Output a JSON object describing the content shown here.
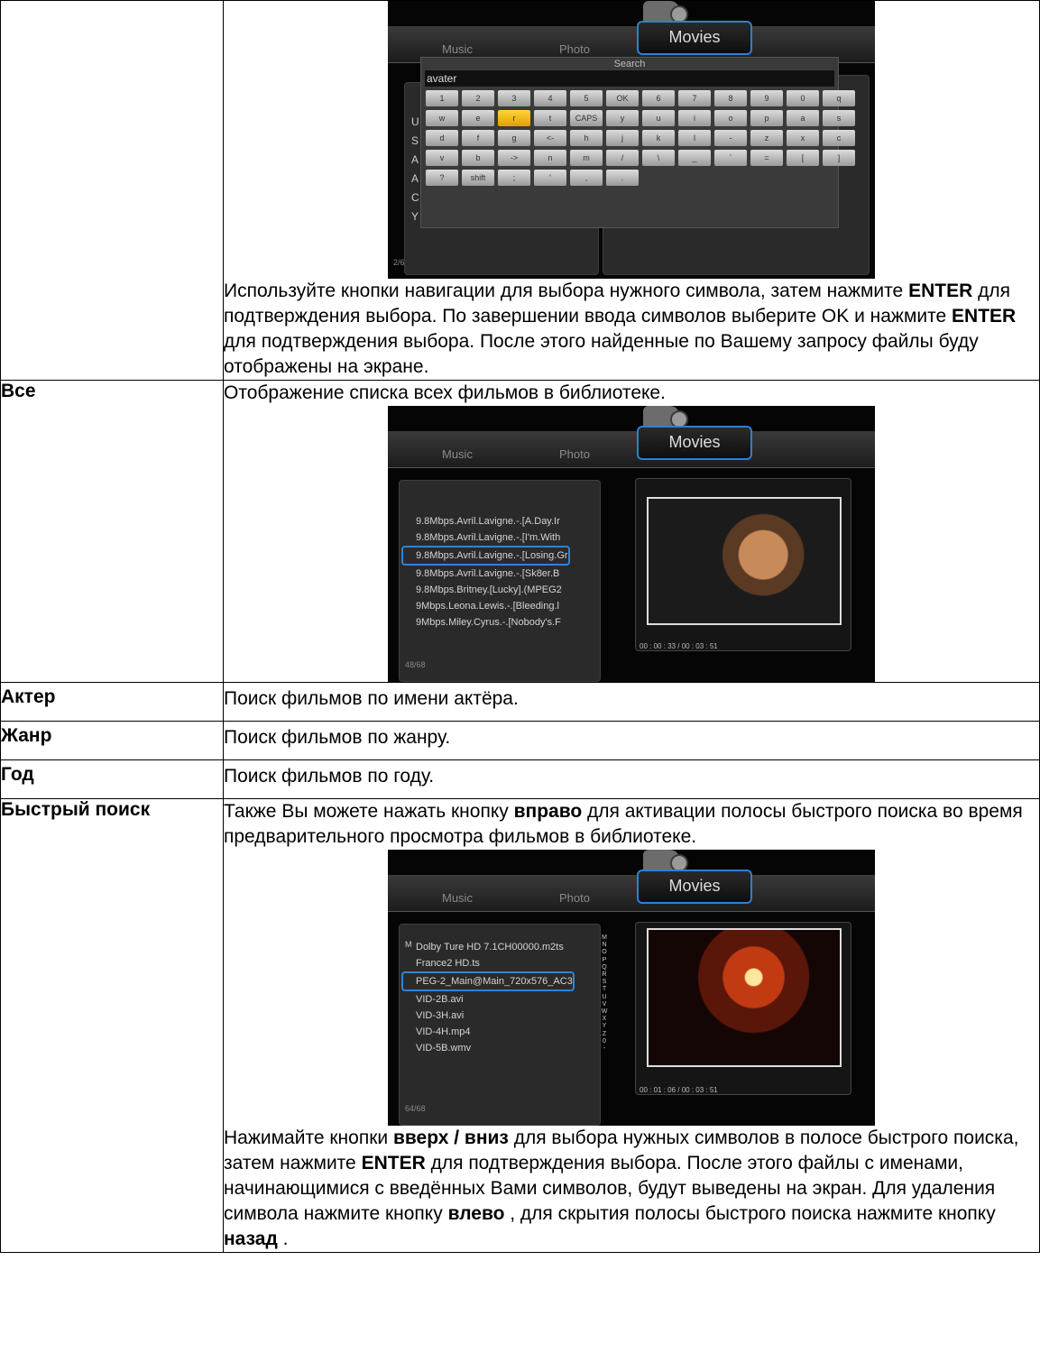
{
  "rows": [
    {
      "term": "",
      "paragraphs": [
        [
          {
            "t": "Используйте кнопки навигации для выбора нужного символа, затем нажмите ",
            "b": false
          },
          {
            "t": "ENTER",
            "b": true
          },
          {
            "t": " для подтверждения выбора. По завершении ввода символов выберите OK и нажмите ",
            "b": false
          },
          {
            "t": "ENTER",
            "b": true
          },
          {
            "t": " для подтверждения выбора. После этого найденные по Вашему запросу файлы буду отображены на экране.",
            "b": false
          }
        ]
      ]
    },
    {
      "term": "Все",
      "paragraphs": [
        [
          {
            "t": "Отображение списка всех фильмов в библиотеке.",
            "b": false
          }
        ]
      ]
    },
    {
      "term": "Актер",
      "paragraphs": [
        [
          {
            "t": "Поиск фильмов по имени актёра.",
            "b": false
          }
        ]
      ]
    },
    {
      "term": "Жанр",
      "paragraphs": [
        [
          {
            "t": "Поиск фильмов по жанру.",
            "b": false
          }
        ]
      ]
    },
    {
      "term": "Год",
      "paragraphs": [
        [
          {
            "t": "Поиск фильмов по году.",
            "b": false
          }
        ]
      ]
    },
    {
      "term": "Быстрый поиск",
      "paragraphs": [
        [
          {
            "t": "Также Вы можете нажать кнопку ",
            "b": false
          },
          {
            "t": "вправо",
            "b": true
          },
          {
            "t": " для активации полосы быстрого поиска  во время предварительного просмотра фильмов в библиотеке.",
            "b": false
          }
        ],
        [
          {
            "t": "Нажимайте кнопки ",
            "b": false
          },
          {
            "t": "вверх / вниз",
            "b": true
          },
          {
            "t": " для выбора нужных символов в полосе быстрого поиска, затем нажмите ",
            "b": false
          },
          {
            "t": "ENTER",
            "b": true
          },
          {
            "t": " для подтверждения выбора. После этого файлы с именами, начинающимися с введённых Вами символов, будут выведены на экран. Для удаления символа нажмите кнопку ",
            "b": false
          },
          {
            "t": "влево",
            "b": true
          },
          {
            "t": " , для скрытия полосы быстрого поиска нажмите кнопку ",
            "b": false
          },
          {
            "t": "назад",
            "b": true
          },
          {
            "t": " .",
            "b": false
          }
        ]
      ]
    }
  ],
  "tabs": {
    "music": "Music",
    "photo": "Photo",
    "movies": "Movies"
  },
  "search_screen": {
    "title": "Search",
    "query": "avater",
    "keys": [
      "1",
      "2",
      "3",
      "4",
      "5",
      "OK",
      "6",
      "7",
      "8",
      "9",
      "0",
      "q",
      "w",
      "e",
      "r",
      "t",
      "CAPS",
      "y",
      "u",
      "i",
      "o",
      "p",
      "a",
      "s",
      "d",
      "f",
      "g",
      "<-",
      "h",
      "j",
      "k",
      "l",
      "-",
      "z",
      "x",
      "c",
      "v",
      "b",
      "->",
      "n",
      "m",
      "/",
      "\\",
      "_",
      "`",
      "=",
      "[",
      "]",
      "?",
      "shift",
      ";",
      "'",
      ",",
      "."
    ],
    "selected_key": "r",
    "side_letters": [
      "U",
      "S",
      "A",
      "A",
      "C",
      "Y"
    ],
    "count": "2/6"
  },
  "all_screen": {
    "items": [
      "9.8Mbps.Avril.Lavigne.-.[A.Day.Ir",
      "9.8Mbps.Avril.Lavigne.-.[I'm.With",
      "9.8Mbps.Avril.Lavigne.-.[Losing.Gr",
      "9.8Mbps.Avril.Lavigne.-.[Sk8er.B",
      "9.8Mbps.Britney.[Lucky].(MPEG2",
      "9Mbps.Leona.Lewis.-.[Bleeding.l",
      "9Mbps.Miley.Cyrus.-.[Nobody's.F"
    ],
    "selected": 2,
    "count": "48/68",
    "time": "00 : 00 : 33 / 00 : 03 : 51"
  },
  "quick_screen": {
    "header": "M",
    "items": [
      "Dolby Ture HD 7.1CH00000.m2ts",
      "France2 HD.ts",
      "PEG-2_Main@Main_720x576_AC3",
      "VID-2B.avi",
      "VID-3H.avi",
      "VID-4H.mp4",
      "VID-5B.wmv"
    ],
    "selected": 2,
    "count": "64/68",
    "time": "00 : 01 : 06 / 00 : 03 : 51",
    "alphabet": [
      "M",
      "N",
      "O",
      "P",
      "Q",
      "R",
      "S",
      "T",
      "U",
      "V",
      "W",
      "X",
      "Y",
      "Z",
      "0",
      "-"
    ]
  }
}
